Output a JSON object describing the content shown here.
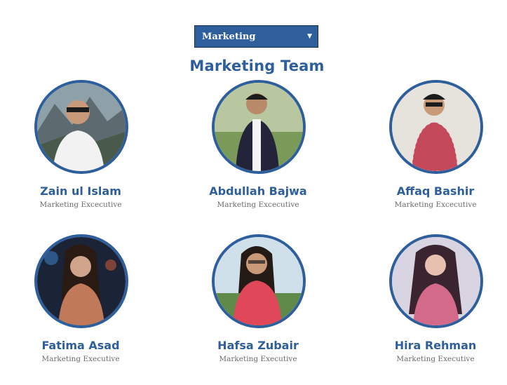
{
  "department_select": {
    "selected": "Marketing",
    "caret_icon": "caret-down-icon"
  },
  "team_title": "Marketing Team",
  "members": [
    {
      "name": "Zain ul Islam",
      "role": "Marketing Excecutive",
      "avatar": "photo-avatar-icon"
    },
    {
      "name": "Abdullah Bajwa",
      "role": "Marketing Excecutive",
      "avatar": "photo-avatar-icon"
    },
    {
      "name": "Affaq Bashir",
      "role": "Marketing Excecutive",
      "avatar": "photo-avatar-icon"
    },
    {
      "name": "Fatima Asad",
      "role": "Marketing Executive",
      "avatar": "photo-avatar-icon"
    },
    {
      "name": "Hafsa Zubair",
      "role": "Marketing Executive",
      "avatar": "photo-avatar-icon"
    },
    {
      "name": "Hira Rehman",
      "role": "Marketing Executive",
      "avatar": "photo-avatar-icon"
    }
  ],
  "colors": {
    "accent": "#2e5f9c",
    "role_text": "#6b6b6b"
  }
}
